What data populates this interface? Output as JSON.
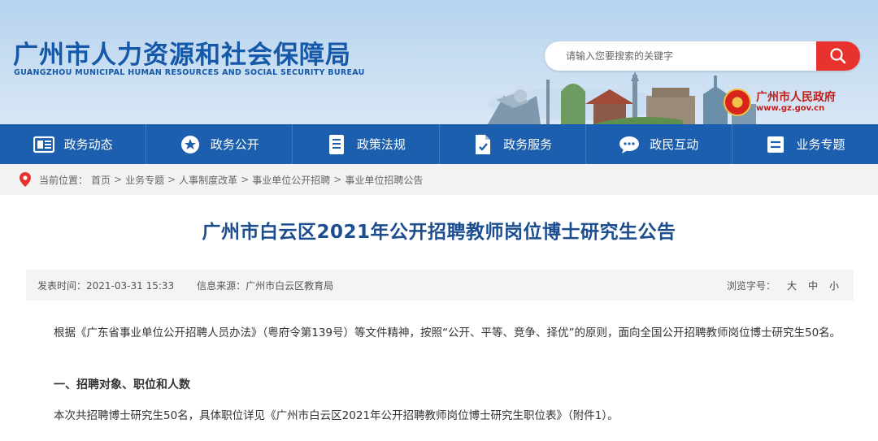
{
  "header": {
    "title": "广州市人力资源和社会保障局",
    "subtitle": "GUANGZHOU MUNICIPAL HUMAN RESOURCES AND SOCIAL SECURITY BUREAU",
    "search_placeholder": "请输入您要搜索的关键字",
    "gov_logo_name": "广州市人民政府",
    "gov_logo_url": "www.gz.gov.cn"
  },
  "nav": {
    "items": [
      {
        "label": "政务动态",
        "icon": "news-icon"
      },
      {
        "label": "政务公开",
        "icon": "star-icon"
      },
      {
        "label": "政策法规",
        "icon": "document-icon"
      },
      {
        "label": "政务服务",
        "icon": "service-icon"
      },
      {
        "label": "政民互动",
        "icon": "chat-icon"
      },
      {
        "label": "业务专题",
        "icon": "list-icon"
      }
    ]
  },
  "breadcrumb": {
    "label": "当前位置：",
    "items": [
      "首页",
      "业务专题",
      "人事制度改革",
      "事业单位公开招聘",
      "事业单位招聘公告"
    ],
    "separator": ">"
  },
  "article": {
    "title": "广州市白云区2021年公开招聘教师岗位博士研究生公告",
    "publish_label": "发表时间：",
    "publish_time": "2021-03-31 15:33",
    "source_label": "信息来源：",
    "source": "广州市白云区教育局",
    "font_size_label": "浏览字号：",
    "font_sizes": [
      "大",
      "中",
      "小"
    ],
    "paragraph_1": "根据《广东省事业单位公开招聘人员办法》（粤府令第139号）等文件精神，按照“公开、平等、竞争、择优”的原则，面向全国公开招聘教师岗位博士研究生50名。",
    "heading_1": "一、招聘对象、职位和人数",
    "paragraph_2": "本次共招聘博士研究生50名，具体职位详见《广州市白云区2021年公开招聘教师岗位博士研究生职位表》（附件1）。"
  },
  "colors": {
    "nav_bg": "#1c5fae",
    "brand": "#1559a8",
    "search_button": "#e8322d",
    "title": "#1c4e8f"
  }
}
